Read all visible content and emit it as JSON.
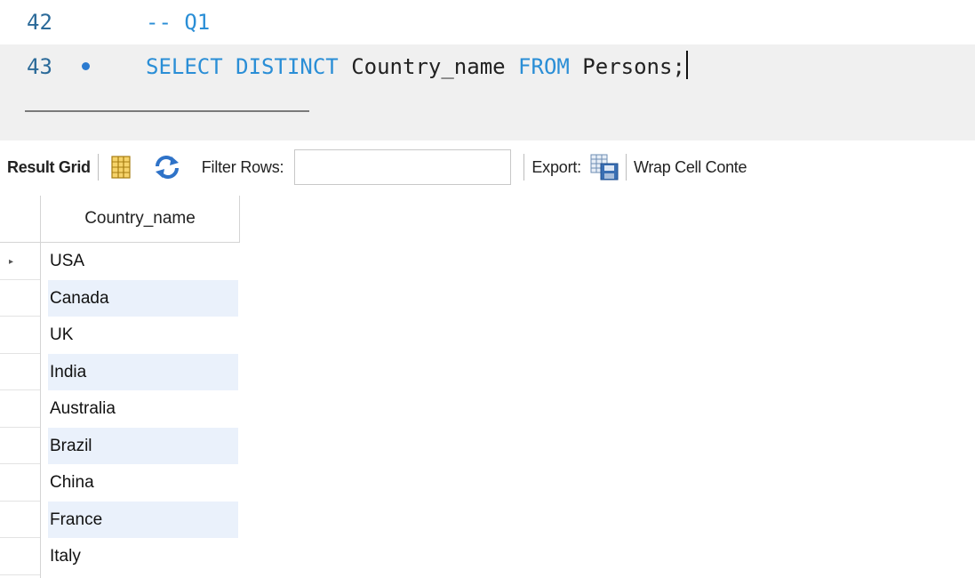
{
  "editor": {
    "lines": [
      {
        "number": "42",
        "comment": "-- Q1"
      },
      {
        "number": "43",
        "kw1": "SELECT",
        "kw2": "DISTINCT",
        "col": "Country_name",
        "kw3": "FROM",
        "table": "Persons;"
      }
    ]
  },
  "toolbar": {
    "result_grid_label": "Result Grid",
    "filter_label": "Filter Rows:",
    "filter_value": "",
    "export_label": "Export:",
    "wrap_label": "Wrap Cell Conte",
    "icons": [
      "grid-layout-icon",
      "refresh-icon",
      "export-icon"
    ]
  },
  "grid": {
    "columns": [
      "Country_name"
    ],
    "rows": [
      "USA",
      "Canada",
      "UK",
      "India",
      "Australia",
      "Brazil",
      "China",
      "France",
      "Italy"
    ]
  },
  "colors": {
    "keyword": "#2a8ed6",
    "line_number": "#2b6a99",
    "alt_row": "#eaf1fb",
    "active_line": "#f0f0f0"
  }
}
